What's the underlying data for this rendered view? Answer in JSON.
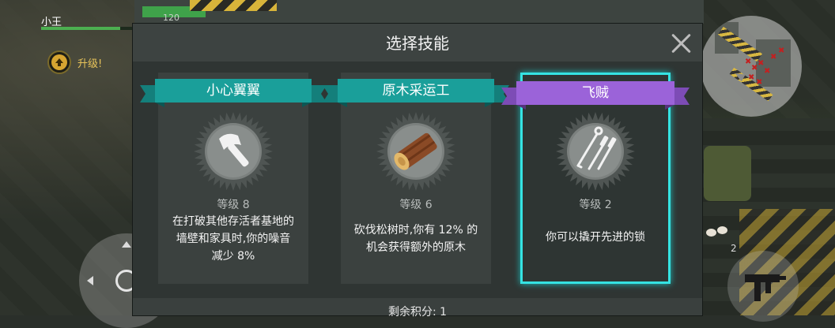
{
  "hud": {
    "player_name": "小王",
    "hp_value": "120",
    "hp_fraction": 0.85,
    "level_up_label": "升级!",
    "ammo_count": "2"
  },
  "modal": {
    "title": "选择技能",
    "remaining_points_label": "剩余积分:",
    "remaining_points_value": "1"
  },
  "skills": [
    {
      "name": "小心翼翼",
      "level": "等级 8",
      "desc_lines": [
        "在打破其他存活者基地的",
        "墙壁和家具时,你的噪音",
        "减少 8%"
      ],
      "icon": "axe-icon",
      "ribbon_color": "#1a9f9a",
      "selected": false
    },
    {
      "name": "原木采运工",
      "level": "等级 6",
      "desc_lines": [
        "砍伐松树时,你有 12% 的",
        "机会获得额外的原木"
      ],
      "icon": "log-icon",
      "ribbon_color": "#1a9f9a",
      "selected": false
    },
    {
      "name": "飞贼",
      "level": "等级 2",
      "desc_lines": [
        "你可以撬开先进的锁"
      ],
      "icon": "lockpick-icon",
      "ribbon_color": "#9b63d9",
      "selected": true
    }
  ],
  "colors": {
    "selected_border": "#35e3e3",
    "level_up": "#e8c45a",
    "hp_bar": "#4caf50"
  }
}
